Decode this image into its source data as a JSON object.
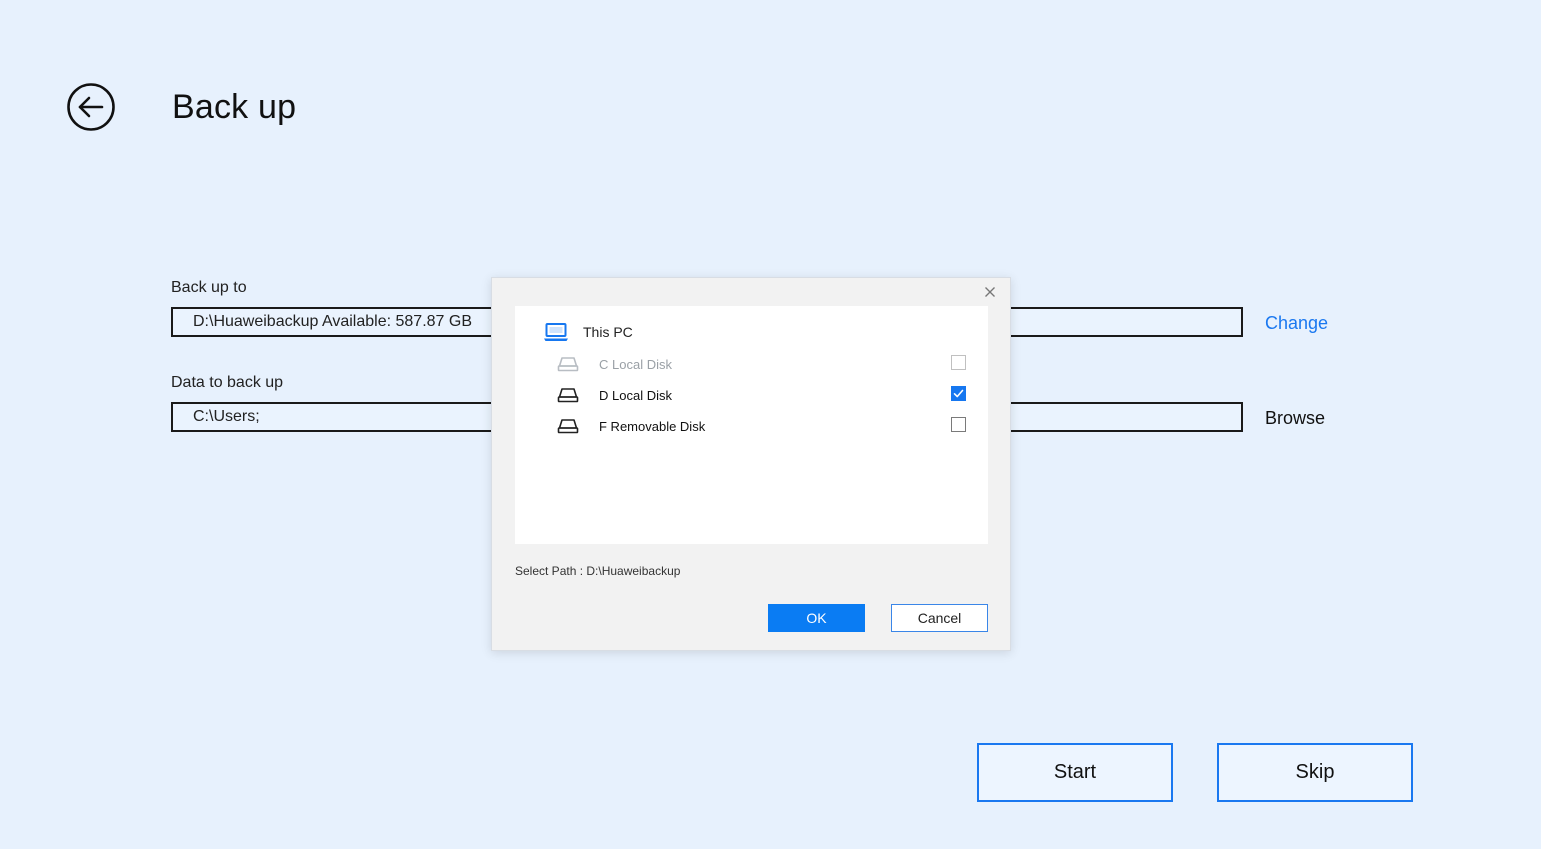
{
  "header": {
    "title": "Back up",
    "back_icon": "back-arrow-icon"
  },
  "form": {
    "backup_to": {
      "label": "Back up to",
      "value": "D:\\Huaweibackup Available: 587.87 GB",
      "action_label": "Change"
    },
    "data_to_backup": {
      "label": "Data to back up",
      "value": "C:\\Users;",
      "action_label": "Browse"
    }
  },
  "dialog": {
    "root_label": "This PC",
    "root_icon": "laptop-icon",
    "disks": [
      {
        "label": "C Local Disk",
        "checked": false,
        "disabled": true
      },
      {
        "label": "D Local Disk",
        "checked": true,
        "disabled": false
      },
      {
        "label": "F Removable Disk",
        "checked": false,
        "disabled": false
      }
    ],
    "select_path": "Select Path : D:\\Huaweibackup",
    "ok_label": "OK",
    "cancel_label": "Cancel"
  },
  "actions": {
    "start_label": "Start",
    "skip_label": "Skip"
  },
  "colors": {
    "background": "#e7f1fd",
    "accent": "#1677f0",
    "link": "#1a78f0"
  }
}
